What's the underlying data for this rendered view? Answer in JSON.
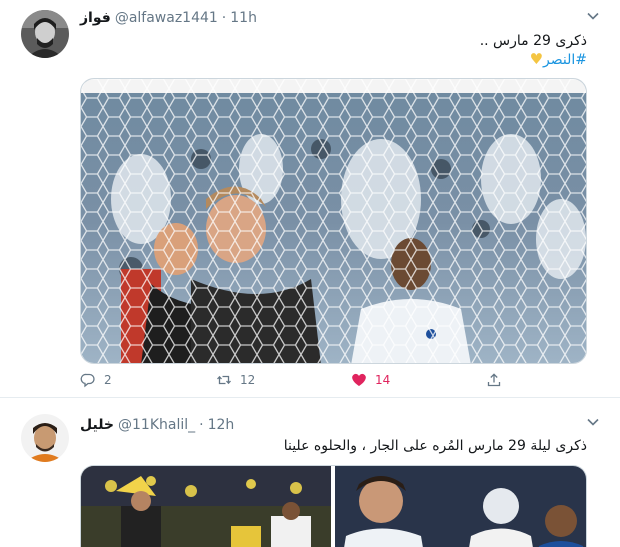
{
  "tweets": [
    {
      "display_name": "فواز",
      "handle": "@alfawaz1441",
      "separator": "·",
      "time": "11h",
      "text_line1": "ذكرى 29 مارس ..",
      "hashtag": "#النصر",
      "emoji": "💛",
      "actions": {
        "reply_count": "2",
        "retweet_count": "12",
        "like_count": "14",
        "liked": true
      }
    },
    {
      "display_name": "خليل",
      "handle": "@11Khalil_",
      "separator": "·",
      "time": "12h",
      "text_line1": "ذكرى ليلة 29 مارس المُره على الجار ، والحلوه علينا"
    }
  ],
  "colors": {
    "link": "#1b95e0",
    "muted": "#657786",
    "like": "#e0245e",
    "border": "#e6ecf0"
  },
  "icons": [
    "chevron-down-icon",
    "reply-icon",
    "retweet-icon",
    "heart-icon",
    "share-icon"
  ]
}
